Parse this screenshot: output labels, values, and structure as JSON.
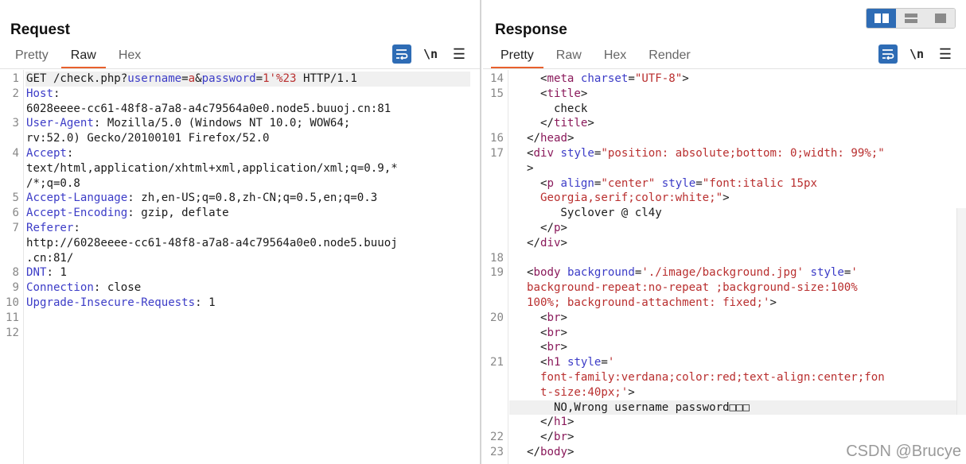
{
  "request": {
    "title": "Request",
    "tabs": [
      "Pretty",
      "Raw",
      "Hex"
    ],
    "active_tab": "Raw",
    "toolbar": {
      "wrap_icon": "wrap-lines-icon",
      "newline_label": "\\n",
      "menu_label": "☰"
    },
    "lines": [
      {
        "n": "1",
        "segs": [
          [
            "p",
            "GET /check.php?"
          ],
          [
            "k",
            "username"
          ],
          [
            "p",
            "="
          ],
          [
            "v",
            "a"
          ],
          [
            "p",
            "&"
          ],
          [
            "k",
            "password"
          ],
          [
            "p",
            "="
          ],
          [
            "v",
            "1'%23"
          ],
          [
            "p",
            " HTTP/1.1"
          ]
        ],
        "hl": true
      },
      {
        "n": "2",
        "segs": [
          [
            "k",
            "Host"
          ],
          [
            "p",
            ":"
          ]
        ]
      },
      {
        "n": "",
        "segs": [
          [
            "p",
            "6028eeee-cc61-48f8-a7a8-a4c79564a0e0.node5.buuoj.cn:81"
          ]
        ]
      },
      {
        "n": "3",
        "segs": [
          [
            "k",
            "User-Agent"
          ],
          [
            "p",
            ": Mozilla/5.0 (Windows NT 10.0; WOW64;"
          ]
        ]
      },
      {
        "n": "",
        "segs": [
          [
            "p",
            "rv:52.0) Gecko/20100101 Firefox/52.0"
          ]
        ]
      },
      {
        "n": "4",
        "segs": [
          [
            "k",
            "Accept"
          ],
          [
            "p",
            ":"
          ]
        ]
      },
      {
        "n": "",
        "segs": [
          [
            "p",
            "text/html,application/xhtml+xml,application/xml;q=0.9,*"
          ]
        ]
      },
      {
        "n": "",
        "segs": [
          [
            "p",
            "/*;q=0.8"
          ]
        ]
      },
      {
        "n": "5",
        "segs": [
          [
            "k",
            "Accept-Language"
          ],
          [
            "p",
            ": zh,en-US;q=0.8,zh-CN;q=0.5,en;q=0.3"
          ]
        ]
      },
      {
        "n": "6",
        "segs": [
          [
            "k",
            "Accept-Encoding"
          ],
          [
            "p",
            ": gzip, deflate"
          ]
        ]
      },
      {
        "n": "7",
        "segs": [
          [
            "k",
            "Referer"
          ],
          [
            "p",
            ":"
          ]
        ]
      },
      {
        "n": "",
        "segs": [
          [
            "p",
            "http://6028eeee-cc61-48f8-a7a8-a4c79564a0e0.node5.buuoj"
          ]
        ]
      },
      {
        "n": "",
        "segs": [
          [
            "p",
            ".cn:81/"
          ]
        ]
      },
      {
        "n": "8",
        "segs": [
          [
            "k",
            "DNT"
          ],
          [
            "p",
            ": 1"
          ]
        ]
      },
      {
        "n": "9",
        "segs": [
          [
            "k",
            "Connection"
          ],
          [
            "p",
            ": close"
          ]
        ]
      },
      {
        "n": "10",
        "segs": [
          [
            "k",
            "Upgrade-Insecure-Requests"
          ],
          [
            "p",
            ": 1"
          ]
        ]
      },
      {
        "n": "11",
        "segs": []
      },
      {
        "n": "12",
        "segs": []
      }
    ]
  },
  "response": {
    "title": "Response",
    "tabs": [
      "Pretty",
      "Raw",
      "Hex",
      "Render"
    ],
    "active_tab": "Pretty",
    "toolbar": {
      "wrap_icon": "wrap-lines-icon",
      "newline_label": "\\n",
      "menu_label": "☰"
    },
    "lines": [
      {
        "n": "14",
        "segs": [
          [
            "p",
            "  <"
          ],
          [
            "t",
            "meta"
          ],
          [
            "p",
            " "
          ],
          [
            "k",
            "charset"
          ],
          [
            "p",
            "="
          ],
          [
            "v",
            "\"UTF-8\""
          ],
          [
            "p",
            ">"
          ]
        ]
      },
      {
        "n": "15",
        "segs": [
          [
            "p",
            "  <"
          ],
          [
            "t",
            "title"
          ],
          [
            "p",
            ">"
          ]
        ]
      },
      {
        "n": "",
        "segs": [
          [
            "p",
            "    check"
          ]
        ]
      },
      {
        "n": "",
        "segs": [
          [
            "p",
            "  </"
          ],
          [
            "t",
            "title"
          ],
          [
            "p",
            ">"
          ]
        ]
      },
      {
        "n": "16",
        "segs": [
          [
            "p",
            "</"
          ],
          [
            "t",
            "head"
          ],
          [
            "p",
            ">"
          ]
        ]
      },
      {
        "n": "17",
        "segs": [
          [
            "p",
            "<"
          ],
          [
            "t",
            "div"
          ],
          [
            "p",
            " "
          ],
          [
            "k",
            "style"
          ],
          [
            "p",
            "="
          ],
          [
            "v",
            "\"position: absolute;bottom: 0;width: 99%;\""
          ]
        ]
      },
      {
        "n": "",
        "segs": [
          [
            "p",
            ">"
          ]
        ]
      },
      {
        "n": "",
        "segs": [
          [
            "p",
            "  <"
          ],
          [
            "t",
            "p"
          ],
          [
            "p",
            " "
          ],
          [
            "k",
            "align"
          ],
          [
            "p",
            "="
          ],
          [
            "v",
            "\"center\""
          ],
          [
            "p",
            " "
          ],
          [
            "k",
            "style"
          ],
          [
            "p",
            "="
          ],
          [
            "v",
            "\"font:italic 15px"
          ]
        ]
      },
      {
        "n": "",
        "segs": [
          [
            "v",
            "  Georgia,serif;color:white;\""
          ],
          [
            "p",
            ">"
          ]
        ]
      },
      {
        "n": "",
        "segs": [
          [
            "p",
            "     Syclover @ cl4y"
          ]
        ]
      },
      {
        "n": "",
        "segs": [
          [
            "p",
            "  </"
          ],
          [
            "t",
            "p"
          ],
          [
            "p",
            ">"
          ]
        ]
      },
      {
        "n": "",
        "segs": [
          [
            "p",
            "</"
          ],
          [
            "t",
            "div"
          ],
          [
            "p",
            ">"
          ]
        ]
      },
      {
        "n": "18",
        "segs": []
      },
      {
        "n": "19",
        "segs": [
          [
            "p",
            "<"
          ],
          [
            "t",
            "body"
          ],
          [
            "p",
            " "
          ],
          [
            "k",
            "background"
          ],
          [
            "p",
            "="
          ],
          [
            "v",
            "'./image/background.jpg'"
          ],
          [
            "p",
            " "
          ],
          [
            "k",
            "style"
          ],
          [
            "p",
            "="
          ],
          [
            "v",
            "'"
          ]
        ]
      },
      {
        "n": "",
        "segs": [
          [
            "v",
            "background-repeat:no-repeat ;background-size:100%"
          ]
        ]
      },
      {
        "n": "",
        "segs": [
          [
            "v",
            "100%; background-attachment: fixed;'"
          ],
          [
            "p",
            ">"
          ]
        ]
      },
      {
        "n": "20",
        "segs": [
          [
            "p",
            "  <"
          ],
          [
            "t",
            "br"
          ],
          [
            "p",
            ">"
          ]
        ]
      },
      {
        "n": "",
        "segs": [
          [
            "p",
            "  <"
          ],
          [
            "t",
            "br"
          ],
          [
            "p",
            ">"
          ]
        ]
      },
      {
        "n": "",
        "segs": [
          [
            "p",
            "  <"
          ],
          [
            "t",
            "br"
          ],
          [
            "p",
            ">"
          ]
        ]
      },
      {
        "n": "21",
        "segs": [
          [
            "p",
            "  <"
          ],
          [
            "t",
            "h1"
          ],
          [
            "p",
            " "
          ],
          [
            "k",
            "style"
          ],
          [
            "p",
            "="
          ],
          [
            "v",
            "'"
          ]
        ]
      },
      {
        "n": "",
        "segs": [
          [
            "v",
            "  font-family:verdana;color:red;text-align:center;fon"
          ]
        ]
      },
      {
        "n": "",
        "segs": [
          [
            "v",
            "  t-size:40px;'"
          ],
          [
            "p",
            ">"
          ]
        ]
      },
      {
        "n": "",
        "segs": [
          [
            "p",
            "    NO,Wrong username password□□□"
          ]
        ],
        "hl": true
      },
      {
        "n": "",
        "segs": [
          [
            "p",
            "  </"
          ],
          [
            "t",
            "h1"
          ],
          [
            "p",
            ">"
          ]
        ]
      },
      {
        "n": "22",
        "segs": [
          [
            "p",
            "  </"
          ],
          [
            "t",
            "br"
          ],
          [
            "p",
            ">"
          ]
        ]
      },
      {
        "n": "23",
        "segs": [
          [
            "p",
            "</"
          ],
          [
            "t",
            "body"
          ],
          [
            "p",
            ">"
          ]
        ]
      }
    ]
  },
  "layout_switch": [
    "split-horizontal-icon",
    "split-vertical-icon",
    "single-pane-icon"
  ],
  "watermark": "CSDN @Brucye",
  "colors": {
    "accent": "#2e6cb5",
    "tab_underline": "#e8602c",
    "key": "#3c3cc7",
    "value": "#b92f2f",
    "tag": "#8a1a5b"
  }
}
